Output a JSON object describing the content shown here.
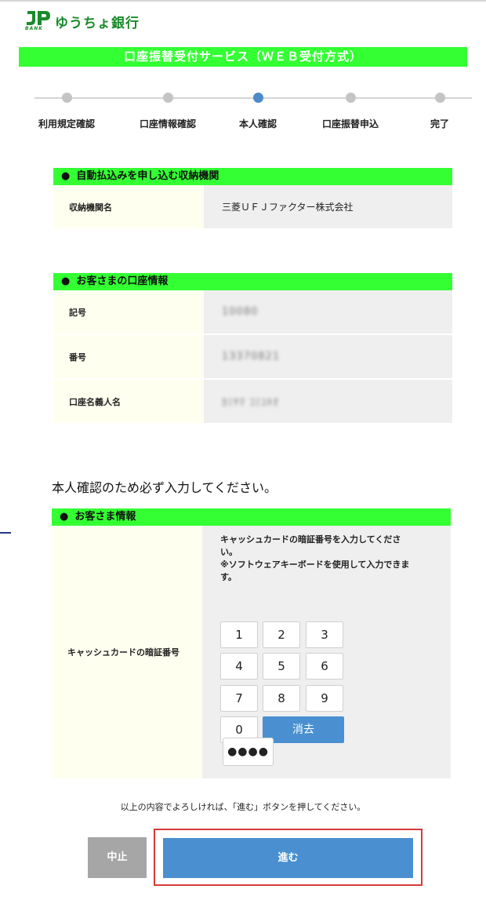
{
  "logo": {
    "bank_label": "BANK",
    "name": "ゆうちょ銀行"
  },
  "title": "口座振替受付サービス（ＷＥＢ受付方式）",
  "steps": [
    {
      "label": "利用規定確認",
      "active": false
    },
    {
      "label": "口座情報確認",
      "active": false
    },
    {
      "label": "本人確認",
      "active": true
    },
    {
      "label": "口座振替申込",
      "active": false
    },
    {
      "label": "完了",
      "active": false
    }
  ],
  "institution": {
    "bullet": "●",
    "heading": "自動払込みを申し込む収納機関",
    "rows": [
      {
        "key": "収納機関名",
        "value": "三菱ＵＦＪファクター株式会社"
      }
    ]
  },
  "account": {
    "bullet": "●",
    "heading": "お客さまの口座情報",
    "rows": [
      {
        "key": "記号",
        "value": "10080"
      },
      {
        "key": "番号",
        "value": "13370821"
      },
      {
        "key": "口座名義人名",
        "value": "ｶﾐﾔﾏ ｺﾐﾕｷｵ"
      }
    ]
  },
  "instruction": "本人確認のため必ず入力してください。",
  "customer": {
    "bullet": "●",
    "heading": "お客さま情報",
    "pin_label": "キャッシュカードの暗証番号",
    "pin_note_1": "キャッシュカードの暗証番号を入力してください。",
    "pin_note_2": "※ソフトウェアキーボードを使用して入力できます。",
    "keys": [
      "1",
      "2",
      "3",
      "4",
      "5",
      "6",
      "7",
      "8",
      "9",
      "0"
    ],
    "clear_label": "消去",
    "pin_value": "●●●●"
  },
  "confirm_text": "以上の内容でよろしければ、「進む」ボタンを押してください。",
  "buttons": {
    "cancel": "中止",
    "next": "進む"
  },
  "colors": {
    "brand_green": "#1a8b2a",
    "header_green": "#33ff33",
    "accent_blue": "#4a90d0",
    "highlight_red": "#d63a3a"
  }
}
